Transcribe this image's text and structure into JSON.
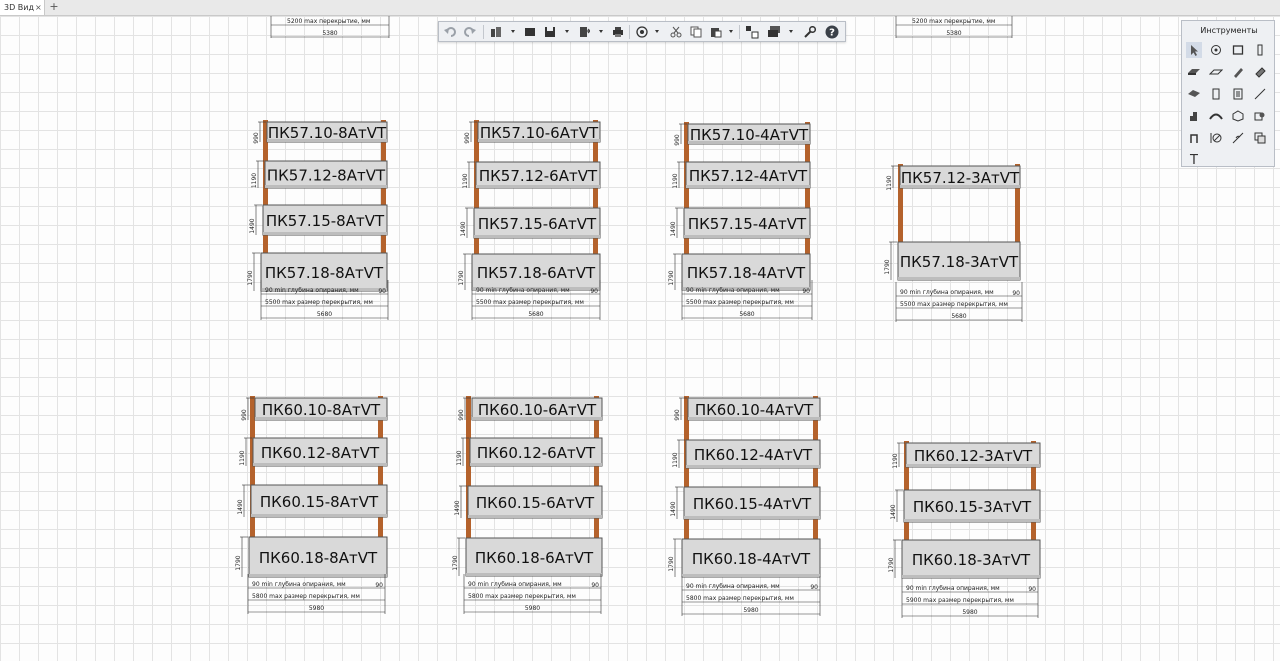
{
  "tabs": [
    {
      "label": "3D Вид"
    }
  ],
  "tab_close": "×",
  "tab_add": "+",
  "toolbar": {
    "buttons": [
      "undo-icon",
      "redo-icon",
      "view-icon",
      "window-icon",
      "save-icon",
      "export-icon",
      "print-icon",
      "orbit-icon",
      "cut-icon",
      "copy-icon",
      "paste-icon",
      "section-icon",
      "layers-icon",
      "settings-icon",
      "help-icon"
    ],
    "help_glyph": "?"
  },
  "palette": {
    "title": "Инструменты",
    "tools": [
      "cursor-icon",
      "orbit-tool-icon",
      "wall-icon",
      "column-icon",
      "slab-icon",
      "roof-icon",
      "beam-icon",
      "stair-icon",
      "door-icon",
      "window-tool-icon",
      "line-icon",
      "mesh-icon",
      "object-icon",
      "shell-icon",
      "morph-icon",
      "zone-icon",
      "railing-icon",
      "curtain-wall-icon",
      "dimension-icon",
      "level-icon",
      "measure-icon",
      "text-icon"
    ],
    "text_glyph": "T"
  },
  "scene": {
    "top_partial": [
      {
        "max_label": "5200 max перекрытие, мм",
        "total": "5380"
      },
      {
        "max_label": "5200 max перекрытие, мм",
        "total": "5380"
      }
    ],
    "groups": [
      {
        "beams": [
          {
            "label": "ПК57.10-8АтVT",
            "dim": "990"
          },
          {
            "label": "ПК57.12-8АтVT",
            "dim": "1190"
          },
          {
            "label": "ПК57.15-8АтVT",
            "dim": "1490"
          },
          {
            "label": "ПК57.18-8АтVT",
            "dim": "1790"
          }
        ],
        "bearing_label": "90 min глубина опирания, мм",
        "bearing_value": "90",
        "max_label": "5500 max размер перекрытия, мм",
        "total": "5680"
      },
      {
        "beams": [
          {
            "label": "ПК57.10-6АтVT",
            "dim": "990"
          },
          {
            "label": "ПК57.12-6АтVT",
            "dim": "1190"
          },
          {
            "label": "ПК57.15-6АтVT",
            "dim": "1490"
          },
          {
            "label": "ПК57.18-6АтVT",
            "dim": "1790"
          }
        ],
        "bearing_label": "90 min глубина опирания, мм",
        "bearing_value": "90",
        "max_label": "5500 max размер перекрытия, мм",
        "total": "5680"
      },
      {
        "beams": [
          {
            "label": "ПК57.10-4АтVT",
            "dim": "990"
          },
          {
            "label": "ПК57.12-4АтVT",
            "dim": "1190"
          },
          {
            "label": "ПК57.15-4АтVT",
            "dim": "1490"
          },
          {
            "label": "ПК57.18-4АтVT",
            "dim": "1790"
          }
        ],
        "bearing_label": "90 min глубина опирания, мм",
        "bearing_value": "90",
        "max_label": "5500 max размер перекрытия, мм",
        "total": "5680"
      },
      {
        "beams": [
          {
            "label": "ПК57.12-3АтVT",
            "dim": "1190"
          },
          {
            "label": "ПК57.18-3АтVT",
            "dim": "1790"
          }
        ],
        "bearing_label": "90 min глубина опирания, мм",
        "bearing_value": "90",
        "max_label": "5500 max размер перекрытия, мм",
        "total": "5680"
      },
      {
        "beams": [
          {
            "label": "ПК60.10-8АтVT",
            "dim": "990"
          },
          {
            "label": "ПК60.12-8АтVT",
            "dim": "1190"
          },
          {
            "label": "ПК60.15-8АтVT",
            "dim": "1490"
          },
          {
            "label": "ПК60.18-8АтVT",
            "dim": "1790"
          }
        ],
        "bearing_label": "90 min глубина опирания, мм",
        "bearing_value": "90",
        "max_label": "5800 max размер перекрытия, мм",
        "total": "5980"
      },
      {
        "beams": [
          {
            "label": "ПК60.10-6АтVT",
            "dim": "990"
          },
          {
            "label": "ПК60.12-6АтVT",
            "dim": "1190"
          },
          {
            "label": "ПК60.15-6АтVT",
            "dim": "1490"
          },
          {
            "label": "ПК60.18-6АтVT",
            "dim": "1790"
          }
        ],
        "bearing_label": "90 min глубина опирания, мм",
        "bearing_value": "90",
        "max_label": "5800 max размер перекрытия, мм",
        "total": "5980"
      },
      {
        "beams": [
          {
            "label": "ПК60.10-4АтVT",
            "dim": "990"
          },
          {
            "label": "ПК60.12-4АтVT",
            "dim": "1190"
          },
          {
            "label": "ПК60.15-4АтVT",
            "dim": "1490"
          },
          {
            "label": "ПК60.18-4АтVT",
            "dim": "1790"
          }
        ],
        "bearing_label": "90 min глубина опирания, мм",
        "bearing_value": "90",
        "max_label": "5800 max размер перекрытия, мм",
        "total": "5980"
      },
      {
        "beams": [
          {
            "label": "ПК60.12-3АтVT",
            "dim": "1190"
          },
          {
            "label": "ПК60.15-3АтVT",
            "dim": "1490"
          },
          {
            "label": "ПК60.18-3АтVT",
            "dim": "1790"
          }
        ],
        "bearing_label": "90 min глубина опирания, мм",
        "bearing_value": "90",
        "max_label": "5900 max размер перекрытия, мм",
        "total": "5980"
      }
    ]
  },
  "colors": {
    "support": "#b4622c",
    "slab": "#d9d9d9",
    "slab_stroke": "#555555",
    "grid": "#e3e3e3"
  }
}
